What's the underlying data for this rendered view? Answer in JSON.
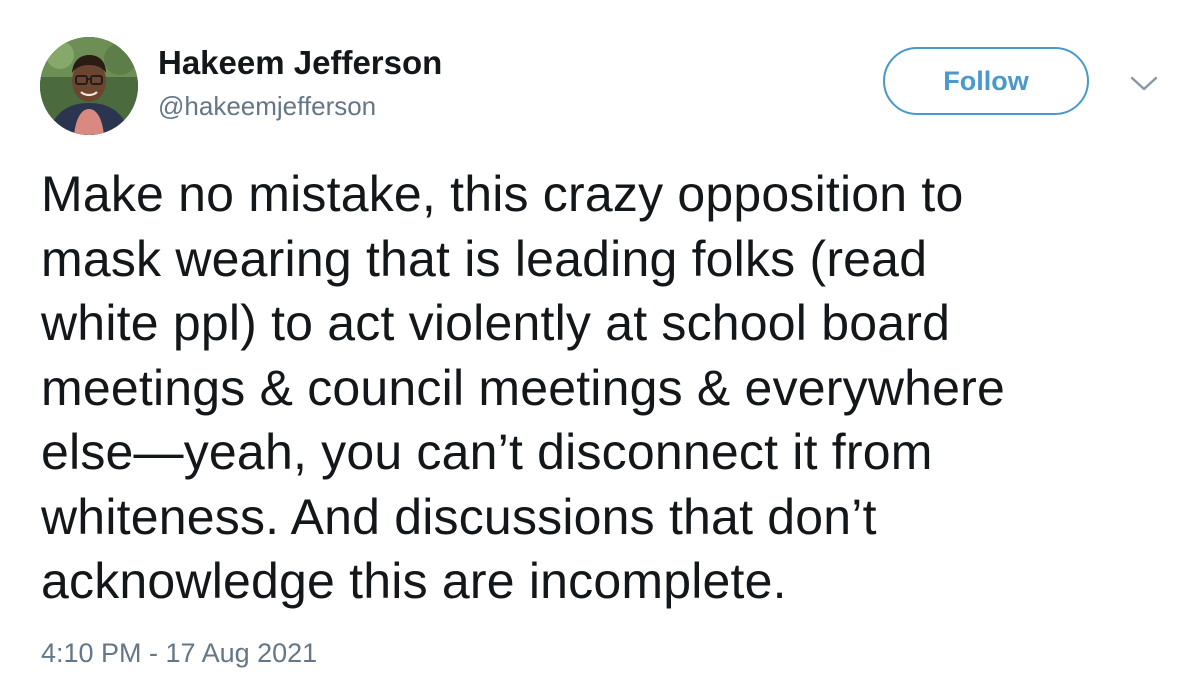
{
  "tweet": {
    "author": {
      "display_name": "Hakeem Jefferson",
      "handle": "@hakeemjefferson",
      "avatar_icon": "profile-photo-icon"
    },
    "follow_label": "Follow",
    "menu_icon": "chevron-down-icon",
    "text": "Make no mistake, this crazy opposition to\nmask wearing that is leading folks (read\nwhite ppl) to act violently at school board\nmeetings & council meetings & everywhere\nelse—yeah, you can’t disconnect it from\nwhiteness. And discussions that don’t\nacknowledge this are incomplete.",
    "timestamp": "4:10 PM - 17 Aug 2021"
  },
  "colors": {
    "accent": "#4a99c9",
    "text": "#14171a",
    "muted": "#657786",
    "background": "#ffffff"
  }
}
